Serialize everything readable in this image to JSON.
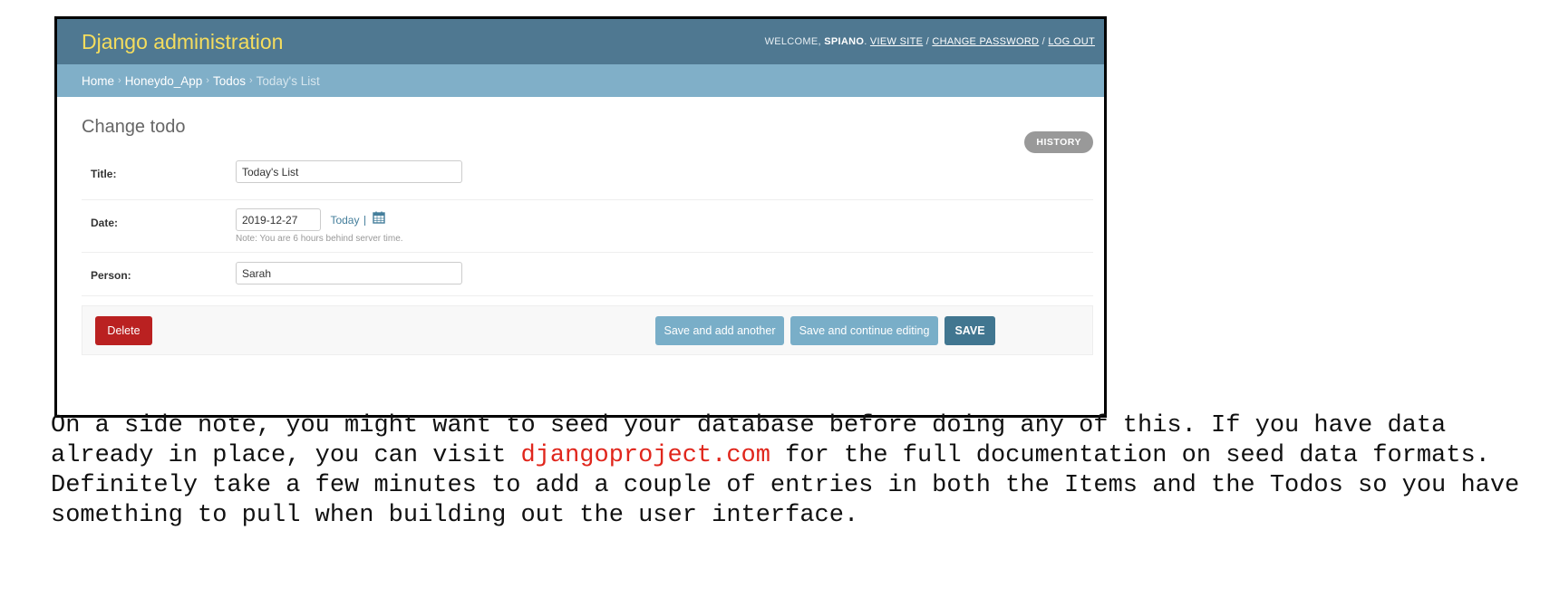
{
  "admin": {
    "brand": "Django administration",
    "user_tools": {
      "welcome": "WELCOME,",
      "username": "SPIANO",
      "view_site": "VIEW SITE",
      "change_password": "CHANGE PASSWORD",
      "log_out": "LOG OUT",
      "separator": "/"
    },
    "breadcrumbs": {
      "home": "Home",
      "app": "Honeydo_App",
      "model": "Todos",
      "current": "Today's List",
      "separator": "›"
    },
    "page_title": "Change todo",
    "history_label": "HISTORY",
    "fields": {
      "title": {
        "label": "Title:",
        "value": "Today's List"
      },
      "date": {
        "label": "Date:",
        "value": "2019-12-27",
        "today_link": "Today",
        "pipe": "|",
        "note": "Note: You are 6 hours behind server time."
      },
      "person": {
        "label": "Person:",
        "value": "Sarah"
      }
    },
    "buttons": {
      "delete": "Delete",
      "save_add_another": "Save and add another",
      "save_continue": "Save and continue editing",
      "save": "SAVE"
    },
    "colors": {
      "header": "#4f7891",
      "breadcrumbs": "#80afc8",
      "brand": "#f5dd5d",
      "delete": "#ba2121",
      "secondary_button": "#79aec8",
      "save": "#417690"
    }
  },
  "note": {
    "text_before": "On a side note, you might want to seed your database before doing any of this. If you have data already in place, you can visit ",
    "link_text": "djangoproject.com",
    "text_after": " for the full documentation on seed data formats. Definitely take a few minutes to add a couple of entries in both the Items and the Todos so you have something to pull when building out the user interface.",
    "link_color": "#e0261c"
  }
}
